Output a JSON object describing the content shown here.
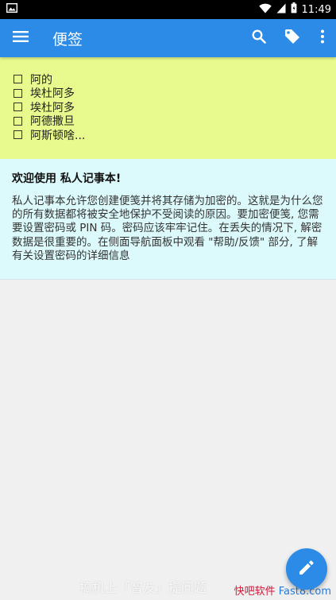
{
  "status_bar": {
    "time": "11:49",
    "icons": [
      "image-notification-icon",
      "wifi-icon",
      "signal-icon",
      "battery-icon"
    ]
  },
  "app_bar": {
    "title": "便签",
    "icons": [
      "menu-icon",
      "search-icon",
      "tag-icon",
      "more-vert-icon"
    ],
    "color": "#2b8be6"
  },
  "notes": {
    "checklist": {
      "color": "#e8fa8e",
      "items": [
        "阿的",
        "埃杜阿多",
        "埃杜阿多",
        "阿德撒旦",
        "阿斯顿啥..."
      ]
    },
    "welcome": {
      "color": "#dcfafc",
      "title": "欢迎使用 私人记事本!",
      "body": "私人记事本允许您创建便笺并将其存储为加密的。这就是为什么您的所有数据都将被安全地保护不受阅读的原因。要加密便笺, 您需要设置密码或 PIN 码。密码应该牢牢记住。在丢失的情况下, 解密数据是很重要的。在侧面导航面板中观看 \"帮助/反馈\" 部分, 了解有关设置密码的详细信息"
    }
  },
  "overlay": {
    "ticker": "搞机上「智友」提问题",
    "watermark_part1": "快吧软件",
    "watermark_part2": " Fast8.com"
  },
  "fab": {
    "icon": "pencil-icon"
  }
}
